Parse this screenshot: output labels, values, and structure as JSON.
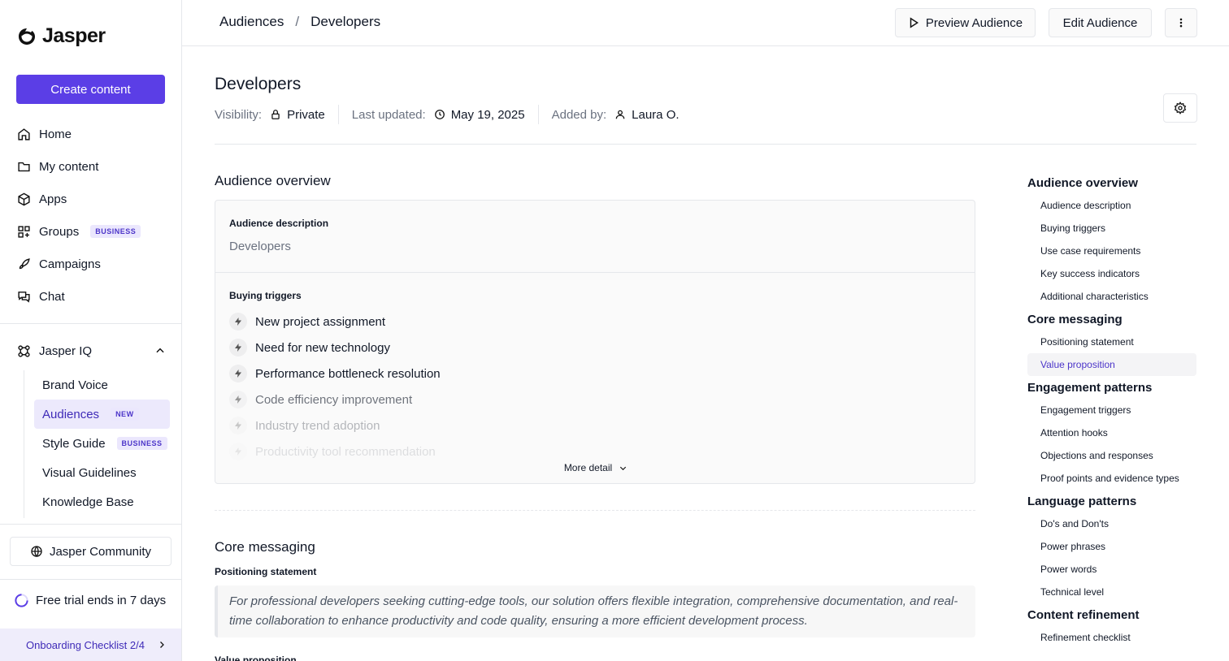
{
  "brand": {
    "name": "Jasper"
  },
  "sidebar": {
    "create_label": "Create content",
    "items": [
      {
        "label": "Home",
        "icon": "home-icon"
      },
      {
        "label": "My content",
        "icon": "folder-icon"
      },
      {
        "label": "Apps",
        "icon": "box-icon"
      },
      {
        "label": "Groups",
        "icon": "grid-icon",
        "badge": "BUSINESS"
      },
      {
        "label": "Campaigns",
        "icon": "rocket-icon"
      },
      {
        "label": "Chat",
        "icon": "chat-icon"
      }
    ],
    "iq": {
      "label": "Jasper IQ",
      "items": [
        {
          "label": "Brand Voice"
        },
        {
          "label": "Audiences",
          "badge": "NEW",
          "active": true
        },
        {
          "label": "Style Guide",
          "badge": "BUSINESS"
        },
        {
          "label": "Visual Guidelines"
        },
        {
          "label": "Knowledge Base"
        }
      ]
    },
    "community_label": "Jasper Community",
    "trial_label": "Free trial ends in 7 days",
    "onboarding_label": "Onboarding Checklist 2/4"
  },
  "topbar": {
    "breadcrumb": [
      "Audiences",
      "/",
      "Developers"
    ],
    "preview_label": "Preview Audience",
    "edit_label": "Edit Audience"
  },
  "page": {
    "title": "Developers",
    "visibility_label": "Visibility:",
    "visibility_value": "Private",
    "updated_label": "Last updated:",
    "updated_value": "May 19, 2025",
    "added_label": "Added by:",
    "added_value": "Laura O."
  },
  "overview": {
    "title": "Audience overview",
    "desc_label": "Audience description",
    "desc_value": "Developers",
    "triggers_label": "Buying triggers",
    "triggers": [
      "New project assignment",
      "Need for new technology",
      "Performance bottleneck resolution",
      "Code efficiency improvement",
      "Industry trend adoption",
      "Productivity tool recommendation"
    ],
    "more_detail": "More detail"
  },
  "core": {
    "title": "Core messaging",
    "pos_label": "Positioning statement",
    "pos_text": "For professional developers seeking cutting-edge tools, our solution offers flexible integration, comprehensive documentation, and real-time collaboration to enhance productivity and code quality, ensuring a more efficient development process.",
    "next_label": "Value proposition"
  },
  "toc": [
    {
      "type": "h",
      "label": "Audience overview"
    },
    {
      "type": "i",
      "label": "Audience description"
    },
    {
      "type": "i",
      "label": "Buying triggers"
    },
    {
      "type": "i",
      "label": "Use case requirements"
    },
    {
      "type": "i",
      "label": "Key success indicators"
    },
    {
      "type": "i",
      "label": "Additional characteristics"
    },
    {
      "type": "h",
      "label": "Core messaging"
    },
    {
      "type": "i",
      "label": "Positioning statement"
    },
    {
      "type": "i",
      "label": "Value proposition",
      "active": true
    },
    {
      "type": "h",
      "label": "Engagement patterns"
    },
    {
      "type": "i",
      "label": "Engagement triggers"
    },
    {
      "type": "i",
      "label": "Attention hooks"
    },
    {
      "type": "i",
      "label": "Objections and responses"
    },
    {
      "type": "i",
      "label": "Proof points and evidence types"
    },
    {
      "type": "h",
      "label": "Language patterns"
    },
    {
      "type": "i",
      "label": "Do's and Don'ts"
    },
    {
      "type": "i",
      "label": "Power phrases"
    },
    {
      "type": "i",
      "label": "Power words"
    },
    {
      "type": "i",
      "label": "Technical level"
    },
    {
      "type": "h",
      "label": "Content refinement"
    },
    {
      "type": "i",
      "label": "Refinement checklist"
    }
  ],
  "colors": {
    "accent": "#5b3ee6",
    "active_bg": "#ece9fc",
    "active_text": "#3f2bb8"
  }
}
